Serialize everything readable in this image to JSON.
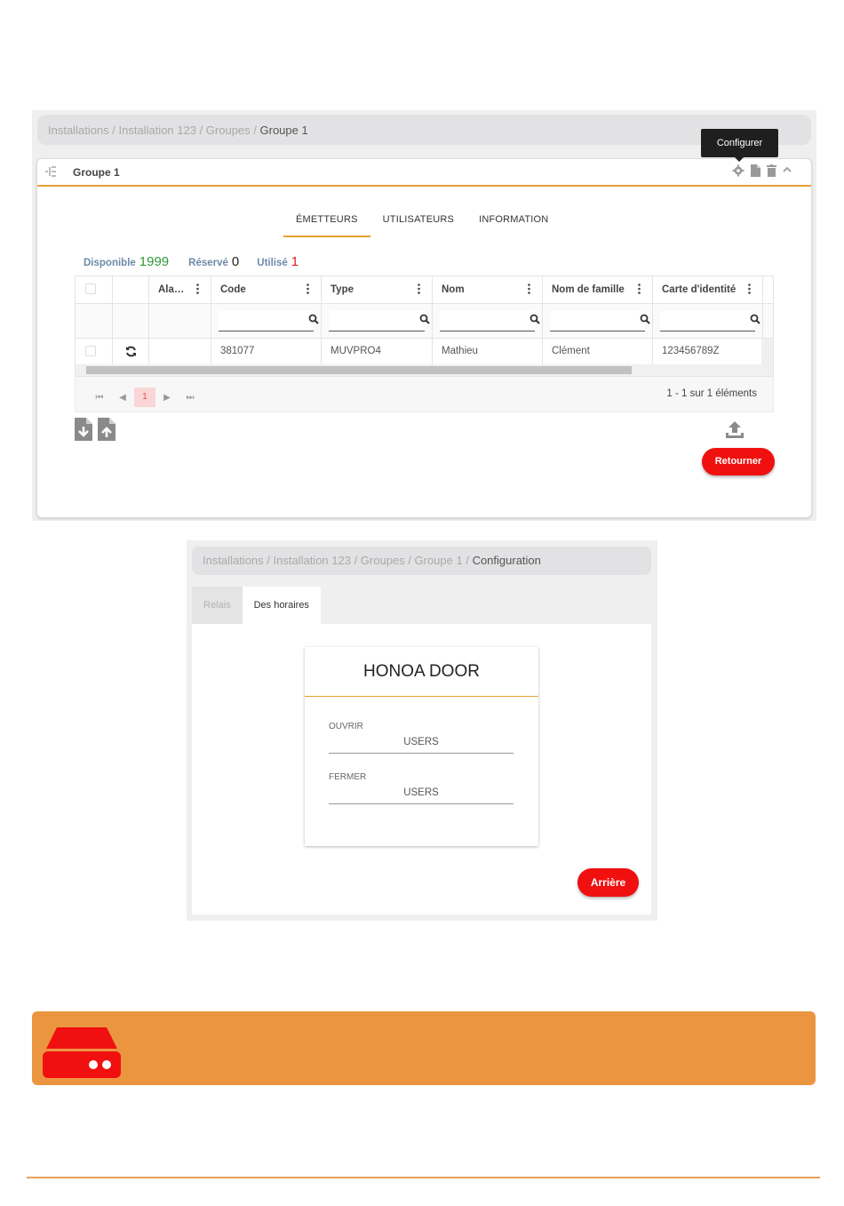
{
  "shot1": {
    "breadcrumb": [
      "Installations",
      "Installation 123",
      "Groupes",
      "Groupe 1"
    ],
    "tooltip": "Configurer",
    "panel_title": "Groupe 1",
    "tabs": [
      {
        "label": "ÉMETTEURS",
        "active": true
      },
      {
        "label": "UTILISATEURS",
        "active": false
      },
      {
        "label": "INFORMATION",
        "active": false
      }
    ],
    "stats": {
      "available_label": "Disponible",
      "available_value": "1999",
      "reserved_label": "Réservé",
      "reserved_value": "0",
      "used_label": "Utilisé",
      "used_value": "1"
    },
    "grid": {
      "columns": [
        "Ala…",
        "Code",
        "Type",
        "Nom",
        "Nom de famille",
        "Carte d'identité"
      ],
      "row": {
        "code": "381077",
        "type": "MUVPRO4",
        "nom": "Mathieu",
        "nom_famille": "Clément",
        "carte": "123456789Z"
      }
    },
    "pager": {
      "current_page": "1",
      "info": "1 - 1 sur 1 éléments"
    },
    "return_button": "Retourner"
  },
  "shot2": {
    "breadcrumb": [
      "Installations",
      "Installation 123",
      "Groupes",
      "Groupe 1",
      "Configuration"
    ],
    "tabs": [
      {
        "label": "Relais",
        "active": false
      },
      {
        "label": "Des horaires",
        "active": true
      }
    ],
    "card_title": "HONOA DOOR",
    "fields": [
      {
        "label": "OUVRIR",
        "value": "USERS"
      },
      {
        "label": "FERMER",
        "value": "USERS"
      }
    ],
    "back_button": "Arrière"
  },
  "colors": {
    "accent": "#e8a033",
    "danger": "#f01010",
    "banner": "#eb9540",
    "available": "#2e9b3a",
    "used": "#e52020"
  }
}
